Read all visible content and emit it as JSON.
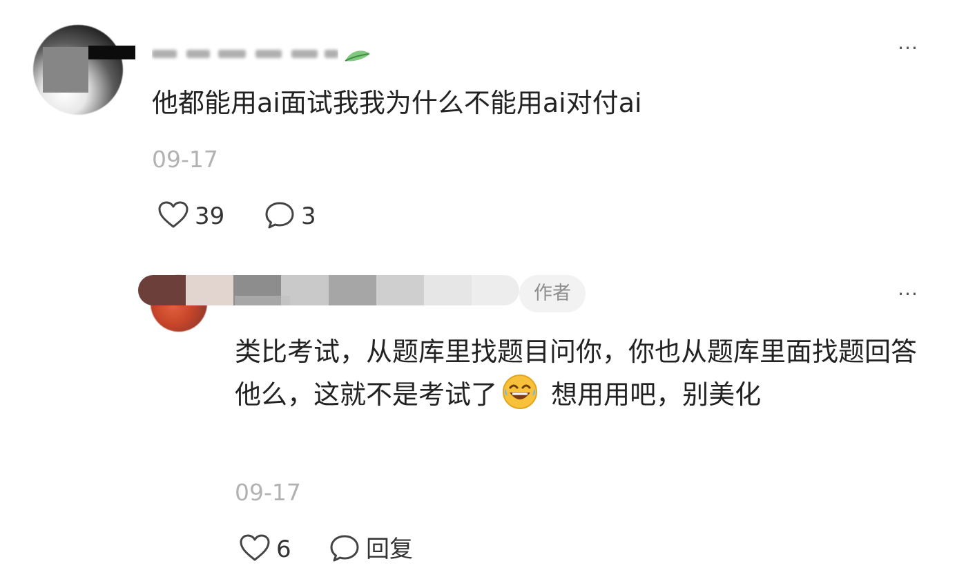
{
  "comment": {
    "text": "他都能用ai面试我我为什么不能用ai对付ai",
    "date": "09-17",
    "likes": "39",
    "replies": "3",
    "more_label": "···"
  },
  "reply": {
    "author_badge": "作者",
    "text_before_emoji": "类比考试，从题库里找题目问你，你也从题库里面找题回答他么，这就不是考试了",
    "text_after_emoji": " 想用用吧，别美化",
    "date": "09-17",
    "likes": "6",
    "reply_label": "回复",
    "more_label": "···"
  },
  "icons": {
    "like": "heart-outline-icon",
    "comment": "speech-bubble-icon",
    "emoji": "laughing-tears-emoji",
    "leaf": "leaf-icon"
  },
  "colors": {
    "text": "#222222",
    "meta": "#b2b2b2",
    "badge_bg": "#f2f2f2",
    "badge_text": "#8e8e8e"
  }
}
